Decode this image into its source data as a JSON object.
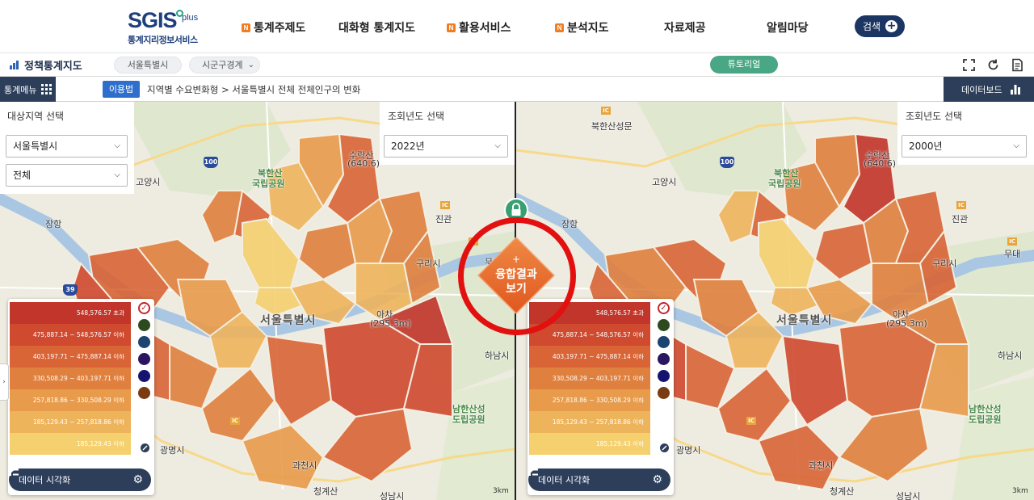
{
  "header": {
    "logo_main": "SGIS",
    "logo_plus": "plus",
    "logo_sub": "통계지리정보서비스",
    "nav": [
      {
        "label": "통계주제도",
        "badge": "N"
      },
      {
        "label": "대화형 통계지도",
        "badge": ""
      },
      {
        "label": "활용서비스",
        "badge": "N"
      },
      {
        "label": "분석지도",
        "badge": "N"
      },
      {
        "label": "자료제공",
        "badge": ""
      },
      {
        "label": "알림마당",
        "badge": ""
      }
    ],
    "search_label": "검색"
  },
  "subbar": {
    "title": "정책통계지도",
    "region_pill": "서울특별시",
    "boundary_pill": "시군구경계",
    "tutorial": "튜토리얼",
    "tools": [
      "fullscreen-icon",
      "refresh-icon",
      "document-icon"
    ]
  },
  "crumbbar": {
    "menu": "통계메뉴",
    "usage": "이용법",
    "breadcrumb": "지역별 수요변화형 > 서울특별시 전체 전체인구의 변화",
    "dashboard": "데이터보드"
  },
  "region_panel": {
    "label": "대상지역 선택",
    "region": "서울특별시",
    "district": "전체"
  },
  "left_map": {
    "year_label": "조회년도 선택",
    "year": "2022년"
  },
  "right_map": {
    "year_label": "조회년도 선택",
    "year": "2000년"
  },
  "legend": {
    "classes": [
      {
        "label": "548,576.57 초과",
        "color": "#c2352a"
      },
      {
        "label": "475,887.14 ~ 548,576.57 이하",
        "color": "#cf4a2f"
      },
      {
        "label": "403,197.71 ~ 475,887.14 이하",
        "color": "#d96436"
      },
      {
        "label": "330,508.29 ~ 403,197.71 이하",
        "color": "#e0803e"
      },
      {
        "label": "257,818.86 ~ 330,508.29 이하",
        "color": "#e89b4b"
      },
      {
        "label": "185,129.43 ~ 257,818.86 이하",
        "color": "#eeb45c"
      },
      {
        "label": "185,129.43 이하",
        "color": "#f4d06f"
      }
    ],
    "palettes": [
      "#c0282d",
      "#2c4a1e",
      "#1c4470",
      "#2a1660",
      "#141470",
      "#7a3a12"
    ],
    "viz_label": "데이터 시각화"
  },
  "fusion": {
    "plus": "+",
    "line1": "융합결과",
    "line2": "보기"
  },
  "map_labels": {
    "goyang": "고양시",
    "janghang": "장항",
    "jingwan": "진관",
    "guri": "구리시",
    "muui": "무대",
    "seoul": "서울특별시",
    "hanam": "하남시",
    "gwangmyeong": "광명시",
    "gwacheon": "과천시",
    "bukhansan": "북한산",
    "national_park": "국립공원",
    "namhansanseong": "남한산성",
    "provincial_park": "도립공원",
    "suraksan": "수락산",
    "suraksan_height": "(640.6)",
    "acha": "아차",
    "acha_height": "(295.3m)",
    "bukhansanseong": "북한산성문",
    "cheonggyesan": "청계산",
    "seongnam": "성남시",
    "scale": "3km",
    "hwy100": "100",
    "hwy39": "39"
  }
}
